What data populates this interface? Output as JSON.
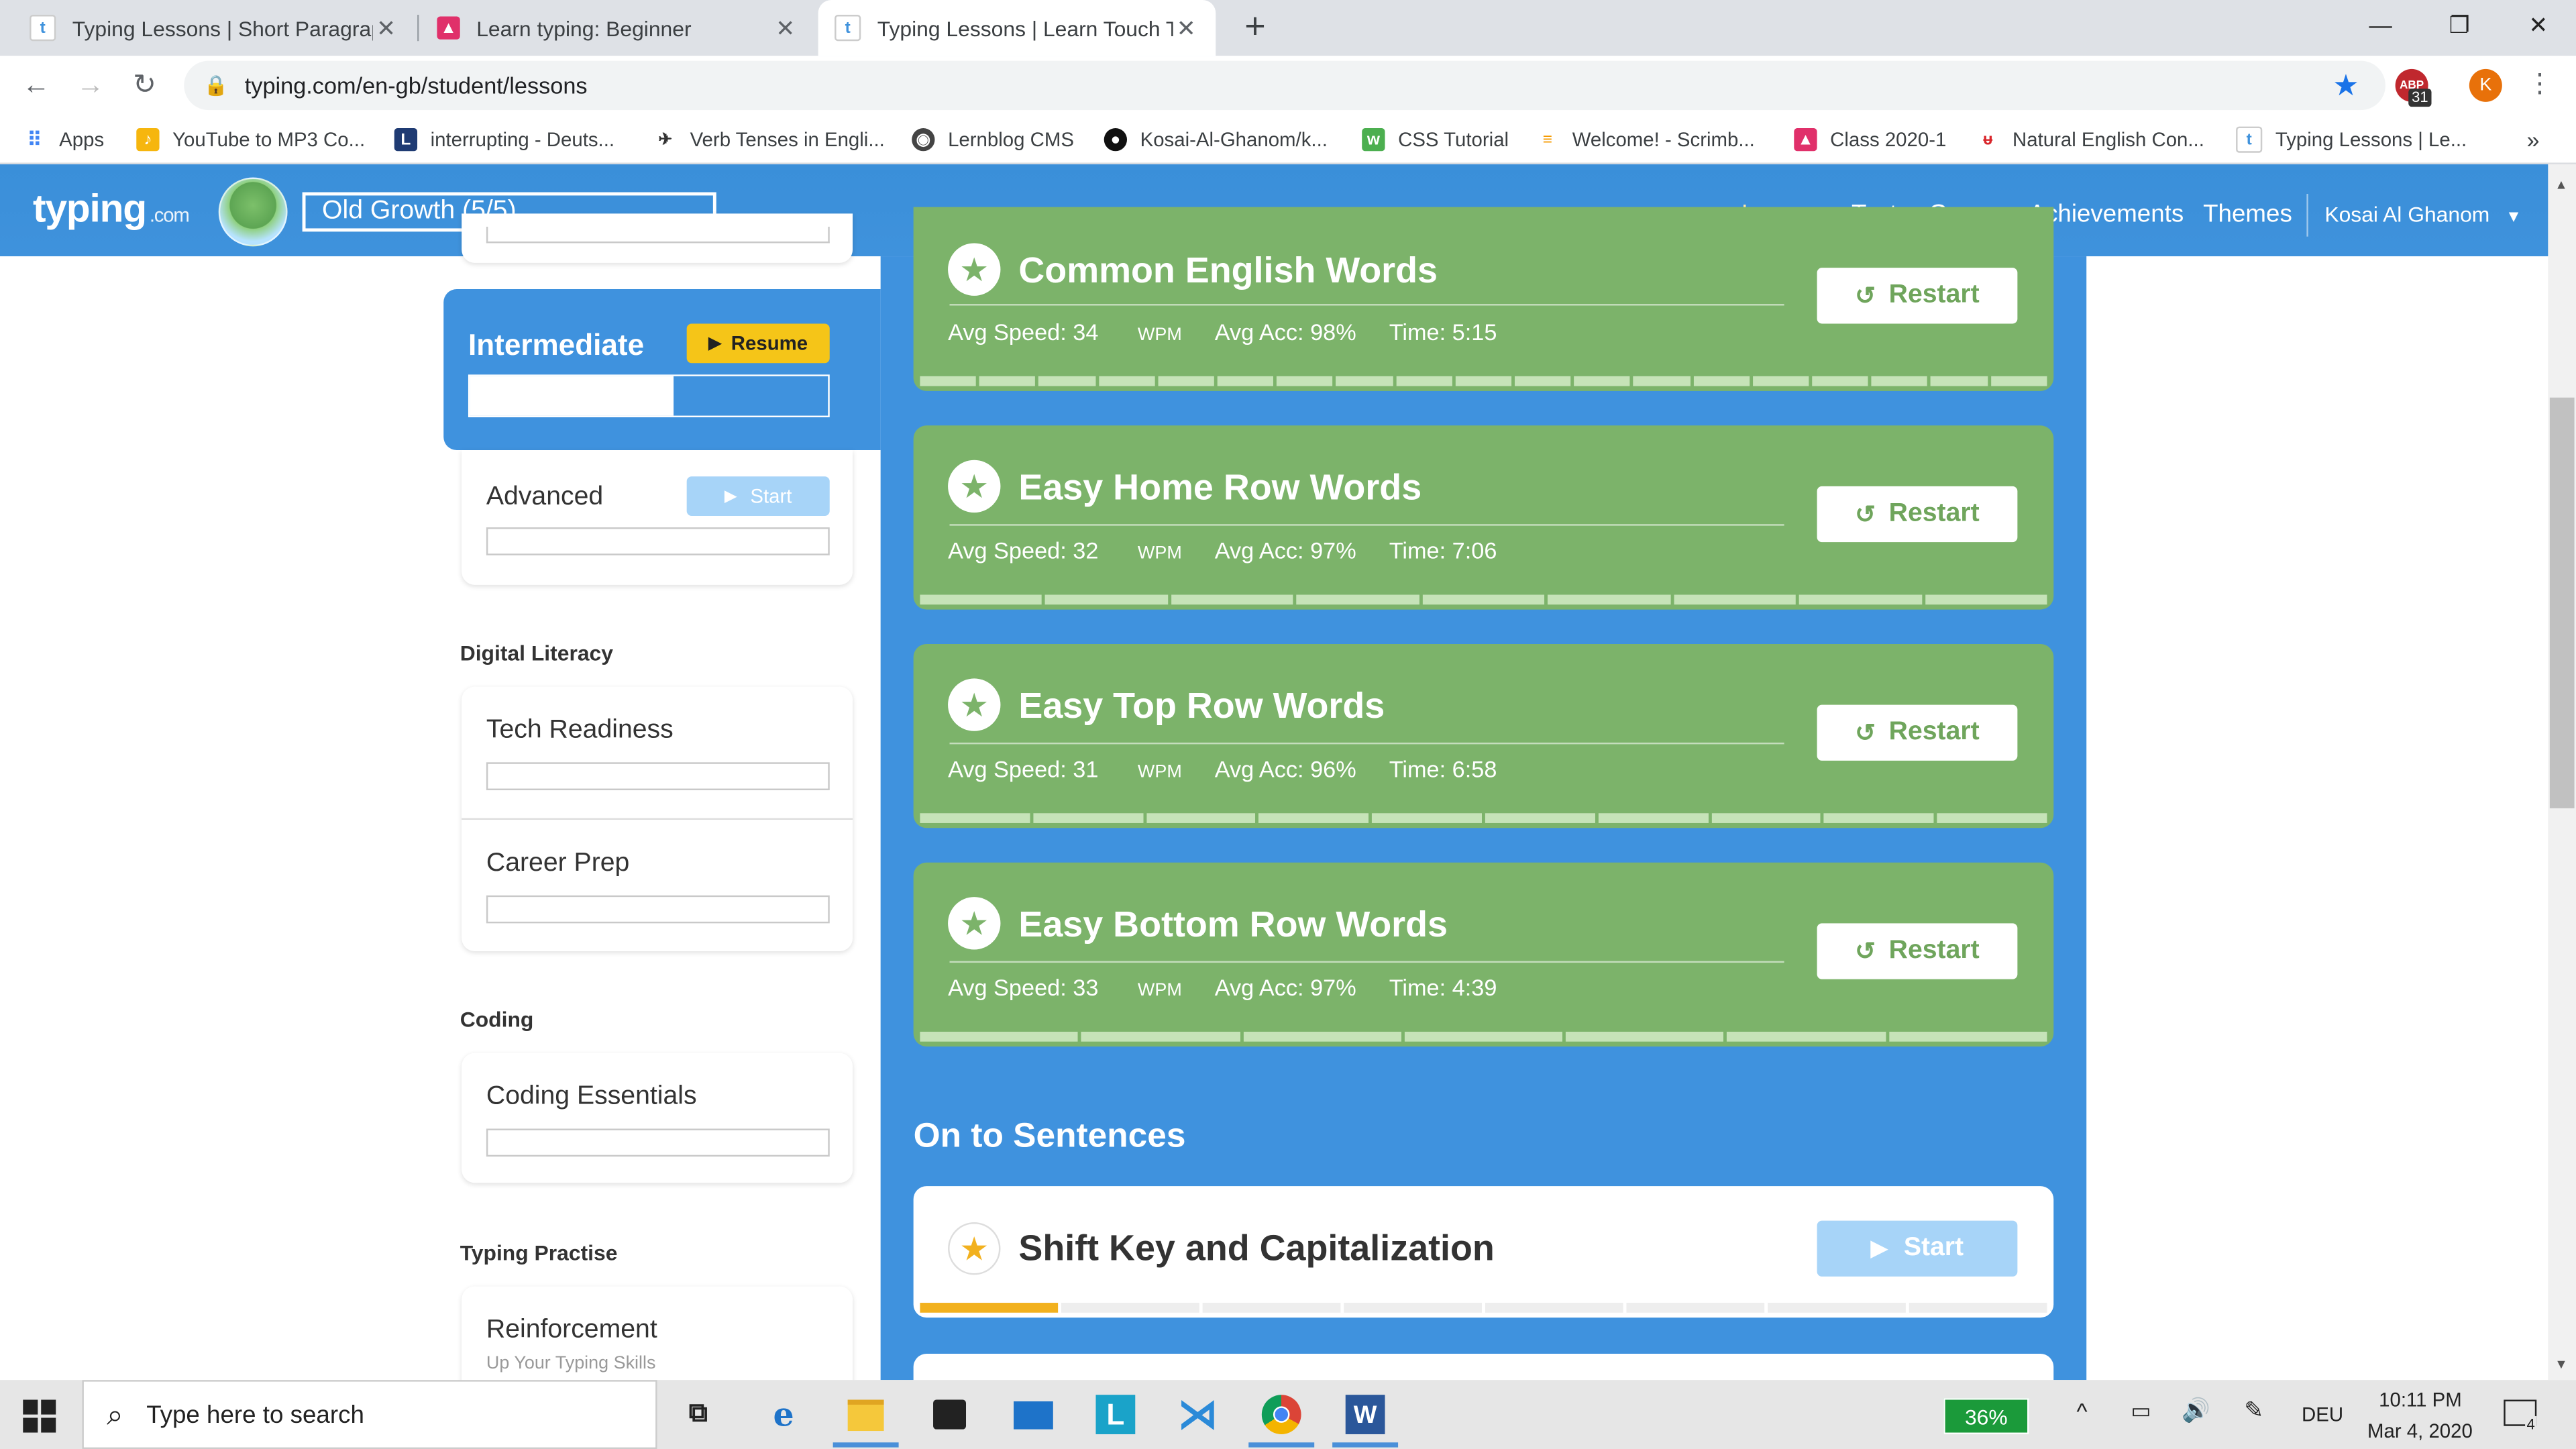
{
  "browser": {
    "tabs": [
      {
        "title": "Typing Lessons | Short Paragraph",
        "fav": "t"
      },
      {
        "title": "Learn typing: Beginner",
        "fav": ""
      },
      {
        "title": "Typing Lessons | Learn Touch Typ",
        "fav": "t"
      }
    ],
    "new_tab_label": "+",
    "url": "typing.com/en-gb/student/lessons",
    "profile_initial": "K",
    "ext_badge": "31",
    "bookmarks": [
      {
        "label": "Apps"
      },
      {
        "label": "YouTube to MP3 Co..."
      },
      {
        "label": "interrupting - Deuts..."
      },
      {
        "label": "Verb Tenses in Engli..."
      },
      {
        "label": "Lernblog CMS"
      },
      {
        "label": "Kosai-Al-Ghanom/k..."
      },
      {
        "label": "CSS Tutorial"
      },
      {
        "label": "Welcome! - Scrimb..."
      },
      {
        "label": "Class 2020-1"
      },
      {
        "label": "Natural English Con..."
      },
      {
        "label": "Typing Lessons | Le..."
      }
    ],
    "bookmarks_overflow": "»"
  },
  "site": {
    "logo": "typing",
    "logo_suffix": ".com",
    "level": "Old Growth (5/5)",
    "nav": [
      "Lessons",
      "Tests",
      "Games",
      "Achievements",
      "Themes"
    ],
    "user": "Kosai Al Ghanom"
  },
  "sidebar": {
    "intermediate": {
      "label": "Intermediate",
      "button": "Resume",
      "progress": 0.57
    },
    "advanced": {
      "label": "Advanced",
      "button": "Start"
    },
    "sections": [
      {
        "title": "Digital Literacy",
        "items": [
          "Tech Readiness",
          "Career Prep"
        ]
      },
      {
        "title": "Coding",
        "items": [
          "Coding Essentials"
        ]
      },
      {
        "title": "Typing Practise",
        "items": [
          "Reinforcement"
        ]
      }
    ],
    "reinforcement_sub": "Up Your Typing Skills"
  },
  "lessons": [
    {
      "title": "Common English Words",
      "speed": "Avg Speed: 34",
      "acc": "Avg Acc: 98%",
      "time": "Time: 5:15",
      "button": "Restart"
    },
    {
      "title": "Easy Home Row Words",
      "speed": "Avg Speed: 32",
      "acc": "Avg Acc: 97%",
      "time": "Time: 7:06",
      "button": "Restart"
    },
    {
      "title": "Easy Top Row Words",
      "speed": "Avg Speed: 31",
      "acc": "Avg Acc: 96%",
      "time": "Time: 6:58",
      "button": "Restart"
    },
    {
      "title": "Easy Bottom Row Words",
      "speed": "Avg Speed: 33",
      "acc": "Avg Acc: 97%",
      "time": "Time: 4:39",
      "button": "Restart"
    }
  ],
  "wpm_unit": "WPM",
  "section_heading": "On to Sentences",
  "sentence_lesson": {
    "title": "Shift Key and Capitalization",
    "button": "Start",
    "progress_segments_done": 1
  },
  "taskbar": {
    "search_placeholder": "Type here to search",
    "battery": "36%",
    "language": "DEU",
    "time": "10:11 PM",
    "date": "Mar 4, 2020",
    "notifications": "4"
  },
  "colors": {
    "header_blue": "#3f92dc",
    "lesson_green": "#7cb36a",
    "resume_yellow": "#f5c518",
    "start_disabled": "#a7d4f8"
  }
}
